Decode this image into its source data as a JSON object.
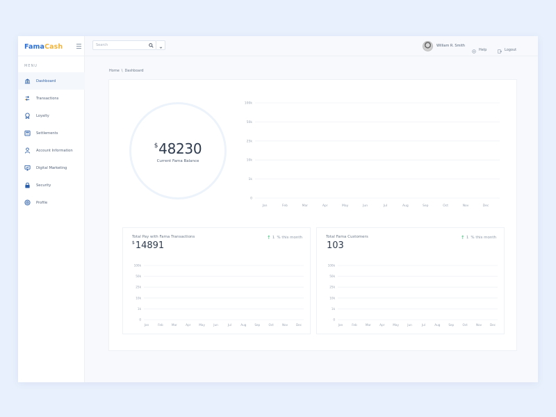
{
  "brand": {
    "part1": "Fama",
    "part2": "Cash"
  },
  "sidebar": {
    "menu_label": "MENU",
    "items": [
      {
        "label": "Dashboard",
        "icon": "bank-icon",
        "active": true
      },
      {
        "label": "Transactions",
        "icon": "transactions-icon",
        "active": false
      },
      {
        "label": "Loyalty",
        "icon": "medal-icon",
        "active": false
      },
      {
        "label": "Settlements",
        "icon": "calculator-icon",
        "active": false
      },
      {
        "label": "Account Information",
        "icon": "user-icon",
        "active": false
      },
      {
        "label": "Digital Marketing",
        "icon": "monitor-icon",
        "active": false
      },
      {
        "label": "Security",
        "icon": "lock-icon",
        "active": false
      },
      {
        "label": "Profile",
        "icon": "target-icon",
        "active": false
      }
    ]
  },
  "topbar": {
    "search_placeholder": "Search",
    "user_name": "William R. Smith",
    "help_label": "Help",
    "logout_label": "Logout"
  },
  "breadcrumb": {
    "home": "Home",
    "separator": "\\",
    "current": "Dashboard"
  },
  "balance": {
    "currency": "$",
    "amount": "48230",
    "label": "Current Fama Balance"
  },
  "cards": [
    {
      "title": "Total Pay with Fama Transactions",
      "currency": "$",
      "value": "14891",
      "trend_value": "1",
      "trend_label": "% this month"
    },
    {
      "title": "Total Fama Customers",
      "currency": "",
      "value": "103",
      "trend_value": "1",
      "trend_label": "% this month"
    }
  ],
  "colors": {
    "primary": "#2b6fd6",
    "accent": "#f2b43a",
    "positive": "#2fbf71"
  },
  "chart_data": [
    {
      "type": "line",
      "categories": [
        "Jan",
        "Feb",
        "Mar",
        "Apr",
        "May",
        "Jun",
        "Jul",
        "Aug",
        "Sep",
        "Oct",
        "Nov",
        "Dec"
      ],
      "series": [],
      "y_ticks": [
        "0",
        "1k",
        "10k",
        "25k",
        "50k",
        "100k"
      ],
      "grid": true
    },
    {
      "type": "line",
      "categories": [
        "Jan",
        "Feb",
        "Mar",
        "Apr",
        "May",
        "Jun",
        "Jul",
        "Aug",
        "Sep",
        "Oct",
        "Nov",
        "Dec"
      ],
      "series": [],
      "y_ticks": [
        "0",
        "1k",
        "10k",
        "25k",
        "50k",
        "100k"
      ],
      "grid": true
    },
    {
      "type": "line",
      "categories": [
        "Jan",
        "Feb",
        "Mar",
        "Apr",
        "May",
        "Jun",
        "Jul",
        "Aug",
        "Sep",
        "Oct",
        "Nov",
        "Dec"
      ],
      "series": [],
      "y_ticks": [
        "0",
        "1k",
        "10k",
        "25k",
        "50k",
        "100k"
      ],
      "grid": true
    }
  ]
}
